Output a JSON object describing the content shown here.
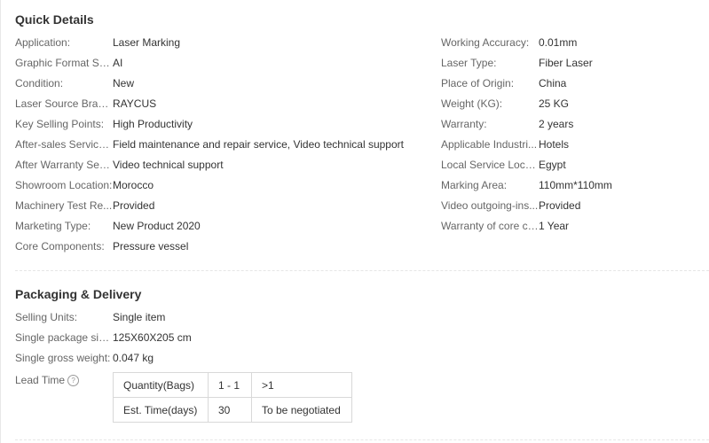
{
  "quick_details": {
    "title": "Quick Details",
    "left": [
      {
        "label": "Application:",
        "value": "Laser Marking"
      },
      {
        "label": "Graphic Format Su...",
        "value": "AI"
      },
      {
        "label": "Condition:",
        "value": "New"
      },
      {
        "label": "Laser Source Brand:",
        "value": "RAYCUS"
      },
      {
        "label": "Key Selling Points:",
        "value": "High Productivity"
      },
      {
        "label": "After-sales Service ...",
        "value": "Field maintenance and repair service, Video technical support"
      },
      {
        "label": "After Warranty Serv...",
        "value": "Video technical support"
      },
      {
        "label": "Showroom Location:",
        "value": "Morocco"
      },
      {
        "label": "Machinery Test Re...",
        "value": "Provided"
      },
      {
        "label": "Marketing Type:",
        "value": "New Product 2020"
      },
      {
        "label": "Core Components:",
        "value": "Pressure vessel"
      }
    ],
    "right": [
      {
        "label": "Working Accuracy:",
        "value": "0.01mm"
      },
      {
        "label": "Laser Type:",
        "value": "Fiber Laser"
      },
      {
        "label": "Place of Origin:",
        "value": "China"
      },
      {
        "label": "Weight (KG):",
        "value": "25 KG"
      },
      {
        "label": "Warranty:",
        "value": "2 years"
      },
      {
        "label": "Applicable Industri...",
        "value": "Hotels"
      },
      {
        "label": "Local Service Locat...",
        "value": "Egypt"
      },
      {
        "label": "Marking Area:",
        "value": "110mm*110mm"
      },
      {
        "label": "Video outgoing-ins...",
        "value": "Provided"
      },
      {
        "label": "Warranty of core co...",
        "value": "1 Year"
      }
    ]
  },
  "packaging": {
    "title": "Packaging & Delivery",
    "rows": [
      {
        "label": "Selling Units:",
        "value": "Single item"
      },
      {
        "label": "Single package size:",
        "value": "125X60X205 cm"
      },
      {
        "label": "Single gross weight:",
        "value": "0.047 kg"
      }
    ],
    "lead_time_label": "Lead Time",
    "help_icon": "?",
    "lead_table": [
      [
        "Quantity(Bags)",
        "1 - 1",
        ">1"
      ],
      [
        "Est. Time(days)",
        "30",
        "To be negotiated"
      ]
    ]
  }
}
